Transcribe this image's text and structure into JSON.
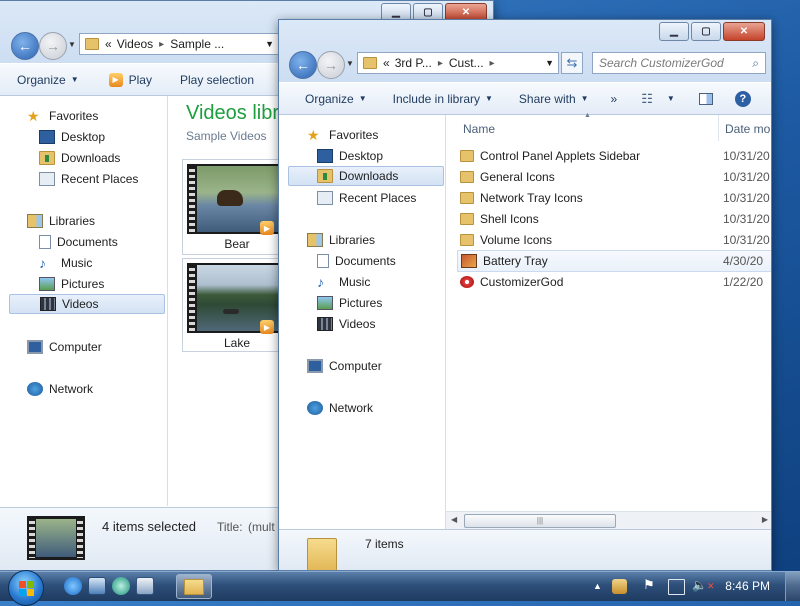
{
  "back_window": {
    "address": {
      "chevron": "«",
      "crumbs": [
        "Videos",
        "Sample ..."
      ]
    },
    "toolbar": {
      "organize": "Organize",
      "play": "Play",
      "play_selection": "Play selection"
    },
    "nav": {
      "favorites": "Favorites",
      "favorites_items": [
        "Desktop",
        "Downloads",
        "Recent Places"
      ],
      "libraries": "Libraries",
      "libraries_items": [
        "Documents",
        "Music",
        "Pictures",
        "Videos"
      ],
      "computer": "Computer",
      "network": "Network"
    },
    "content": {
      "title": "Videos libra",
      "subtitle": "Sample Videos",
      "items": [
        {
          "label": "Bear"
        },
        {
          "label": "Lake"
        }
      ]
    },
    "status": {
      "selected": "4 items selected",
      "title_label": "Title:",
      "title_value": "(mult"
    }
  },
  "front_window": {
    "address": {
      "chevron": "«",
      "crumbs": [
        "3rd P...",
        "Cust..."
      ]
    },
    "search": {
      "placeholder": "Search CustomizerGod"
    },
    "toolbar": {
      "organize": "Organize",
      "include": "Include in library",
      "share": "Share with",
      "more": "»"
    },
    "nav": {
      "favorites": "Favorites",
      "favorites_items": [
        "Desktop",
        "Downloads",
        "Recent Places"
      ],
      "libraries": "Libraries",
      "libraries_items": [
        "Documents",
        "Music",
        "Pictures",
        "Videos"
      ],
      "computer": "Computer",
      "network": "Network"
    },
    "columns": {
      "name": "Name",
      "date": "Date mo"
    },
    "files": [
      {
        "name": "Control Panel Applets Sidebar",
        "date": "10/31/20",
        "type": "folder"
      },
      {
        "name": "General Icons",
        "date": "10/31/20",
        "type": "folder"
      },
      {
        "name": "Network Tray Icons",
        "date": "10/31/20",
        "type": "folder"
      },
      {
        "name": "Shell Icons",
        "date": "10/31/20",
        "type": "folder"
      },
      {
        "name": "Volume Icons",
        "date": "10/31/20",
        "type": "folder"
      },
      {
        "name": "Battery Tray",
        "date": "4/30/20",
        "type": "app"
      },
      {
        "name": "CustomizerGod",
        "date": "1/22/20",
        "type": "app"
      }
    ],
    "status": {
      "count": "7 items"
    }
  },
  "taskbar": {
    "clock": "8:46 PM"
  },
  "colors": {
    "title_blue": "#1e9e3e",
    "accent": "#3b6fb0"
  }
}
